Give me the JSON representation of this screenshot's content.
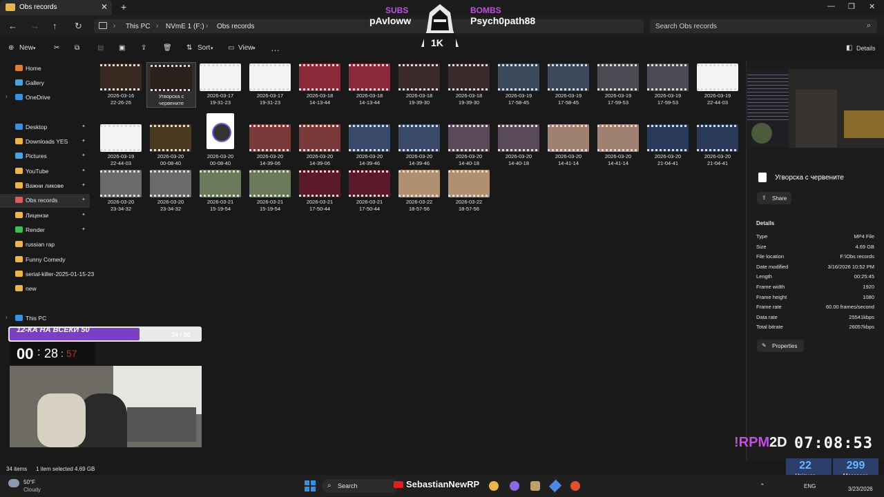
{
  "window": {
    "tab_title": "Obs records",
    "breadcrumb": [
      "This PC",
      "NVmE 1 (F:)",
      "Obs records"
    ],
    "search_placeholder": "Search Obs records"
  },
  "toolbar": {
    "new_label": "New",
    "sort_label": "Sort",
    "view_label": "View",
    "more_label": "…",
    "details_label": "Details"
  },
  "stream_overlay": {
    "subs_label": "SUBS",
    "subs_name": "pAvloww",
    "bombs_label": "BOMBS",
    "bombs_name": "Psych0path88",
    "badge": "1K",
    "goal_title": "12-КА НА ВСЕКИ 50",
    "goal_count": "34 / 50",
    "goal_progress": 0.68,
    "timer_h": "00",
    "timer_m": "28",
    "timer_s": "57",
    "rpm_label": "!RPM",
    "rpm_days": "2D",
    "rpm_clock": "07:08:53",
    "uniques_value": "22",
    "uniques_label": "Uniques",
    "messages_value": "299",
    "messages_label": "Messages",
    "taskbar_overlay_text": "SebastianNewRP"
  },
  "sidebar": {
    "items": [
      {
        "label": "Home",
        "icon": "home-icon",
        "color": "#e07b39",
        "pinned": false
      },
      {
        "label": "Gallery",
        "icon": "gallery-icon",
        "color": "#4aa3df",
        "pinned": false
      },
      {
        "label": "OneDrive",
        "icon": "cloud-icon",
        "color": "#3b8ee0",
        "pinned": false
      },
      {
        "label": "Desktop",
        "icon": "desktop-icon",
        "color": "#3b8ee0",
        "pinned": true
      },
      {
        "label": "Downloads YES",
        "icon": "folder-icon",
        "color": "#e8b64a",
        "pinned": true
      },
      {
        "label": "Pictures",
        "icon": "pictures-icon",
        "color": "#4aa3df",
        "pinned": true
      },
      {
        "label": "YouTube",
        "icon": "folder-icon",
        "color": "#e8b64a",
        "pinned": true
      },
      {
        "label": "Важни ликове",
        "icon": "folder-icon",
        "color": "#e8b64a",
        "pinned": true
      },
      {
        "label": "Obs records",
        "icon": "obs-icon",
        "color": "#e05a5a",
        "pinned": true
      },
      {
        "label": "Лицензи",
        "icon": "folder-icon",
        "color": "#e8b64a",
        "pinned": true
      },
      {
        "label": "Render",
        "icon": "check-icon",
        "color": "#3fbf5a",
        "pinned": true
      },
      {
        "label": "russian rap",
        "icon": "folder-icon",
        "color": "#e8b64a",
        "pinned": false
      },
      {
        "label": "Funny Comedy",
        "icon": "folder-icon",
        "color": "#e8b64a",
        "pinned": false
      },
      {
        "label": "serial-killer-2025-01-15-23",
        "icon": "folder-icon",
        "color": "#e8b64a",
        "pinned": false
      },
      {
        "label": "new",
        "icon": "folder-icon",
        "color": "#e8b64a",
        "pinned": false
      },
      {
        "label": "This PC",
        "icon": "pc-icon",
        "color": "#3b8ee0",
        "pinned": false
      }
    ]
  },
  "files": [
    {
      "name": [
        "2026-03-16",
        "22-26-26"
      ],
      "tone": "#3a2b22"
    },
    {
      "name": [
        "Угворска с",
        "червените"
      ],
      "tone": "#2a211c",
      "selected": true
    },
    {
      "name": [
        "2026-03-17",
        "19-31-23"
      ],
      "tone": "#f4f4f4"
    },
    {
      "name": [
        "2026-03-17",
        "19-31-23"
      ],
      "tone": "#f4f4f4"
    },
    {
      "name": [
        "2026-03-18",
        "14-13-44"
      ],
      "tone": "#8a2a3a"
    },
    {
      "name": [
        "2026-03-18",
        "14-13-44"
      ],
      "tone": "#8a2a3a"
    },
    {
      "name": [
        "2026-03-18",
        "19-39-30"
      ],
      "tone": "#3b2a2a"
    },
    {
      "name": [
        "2026-03-18",
        "19-39-30"
      ],
      "tone": "#3b2a2a"
    },
    {
      "name": [
        "2026-03-19",
        "17-58-45"
      ],
      "tone": "#3a4a5a"
    },
    {
      "name": [
        "2026-03-19",
        "17-58-45"
      ],
      "tone": "#3a4a5a"
    },
    {
      "name": [
        "2026-03-19",
        "17-59-53"
      ],
      "tone": "#4a4a52"
    },
    {
      "name": [
        "2026-03-19",
        "17-59-53"
      ],
      "tone": "#4a4a52"
    },
    {
      "name": [
        "2026-03-19",
        "22-44-03"
      ],
      "tone": "#f4f4f4"
    },
    {
      "name": [
        "2026-03-19",
        "22-44-03"
      ],
      "tone": "#f4f4f4"
    },
    {
      "name": [
        "2026-03-20",
        "00-08-40"
      ],
      "tone": "#4a3a22"
    },
    {
      "name": [
        "2026-03-20",
        "00-08-40"
      ],
      "tone": "#ffffff",
      "doc": true
    },
    {
      "name": [
        "2026-03-20",
        "14-39-06"
      ],
      "tone": "#7a3a3a"
    },
    {
      "name": [
        "2026-03-20",
        "14-39-06"
      ],
      "tone": "#7a3a3a"
    },
    {
      "name": [
        "2026-03-20",
        "14-39-46"
      ],
      "tone": "#3a4a6a"
    },
    {
      "name": [
        "2026-03-20",
        "14-39-46"
      ],
      "tone": "#3a4a6a"
    },
    {
      "name": [
        "2026-03-20",
        "14-40-18"
      ],
      "tone": "#5a4a5a"
    },
    {
      "name": [
        "2026-03-20",
        "14-40-18"
      ],
      "tone": "#5a4a5a"
    },
    {
      "name": [
        "2026-03-20",
        "14-41-14"
      ],
      "tone": "#a08070"
    },
    {
      "name": [
        "2026-03-20",
        "14-41-14"
      ],
      "tone": "#a08070"
    },
    {
      "name": [
        "2026-03-20",
        "21-04-41"
      ],
      "tone": "#2a3a5a"
    },
    {
      "name": [
        "2026-03-20",
        "21-04-41"
      ],
      "tone": "#2a3a5a"
    },
    {
      "name": [
        "2026-03-20",
        "23-34-32"
      ],
      "tone": "#6a6a6a"
    },
    {
      "name": [
        "2026-03-20",
        "23-34-32"
      ],
      "tone": "#6a6a6a"
    },
    {
      "name": [
        "2026-03-21",
        "15-19-54"
      ],
      "tone": "#6a7a5a"
    },
    {
      "name": [
        "2026-03-21",
        "15-19-54"
      ],
      "tone": "#6a7a5a"
    },
    {
      "name": [
        "2026-03-21",
        "17-50-44"
      ],
      "tone": "#5a1a2a"
    },
    {
      "name": [
        "2026-03-21",
        "17-50-44"
      ],
      "tone": "#5a1a2a"
    },
    {
      "name": [
        "2026-03-22",
        "18-57-56"
      ],
      "tone": "#b09070"
    },
    {
      "name": [
        "2026-03-22",
        "18-57-56"
      ],
      "tone": "#b09070"
    }
  ],
  "details": {
    "title": "Угворска с червените",
    "share_label": "Share",
    "section_label": "Details",
    "properties_label": "Properties",
    "rows": [
      {
        "k": "Type",
        "v": "MP4 File"
      },
      {
        "k": "Size",
        "v": "4.69 GB"
      },
      {
        "k": "File location",
        "v": "F:\\Obs records"
      },
      {
        "k": "Date modified",
        "v": "3/16/2026 10:52 PM"
      },
      {
        "k": "Length",
        "v": "00:25:45"
      },
      {
        "k": "Frame width",
        "v": "1920"
      },
      {
        "k": "Frame height",
        "v": "1080"
      },
      {
        "k": "Frame rate",
        "v": "60.00 frames/second"
      },
      {
        "k": "Data rate",
        "v": "25541kbps"
      },
      {
        "k": "Total bitrate",
        "v": "26057kbps"
      }
    ]
  },
  "status": {
    "items_count": "34 items",
    "selection": "1 item selected  4.69 GB"
  },
  "taskbar": {
    "weather_temp": "50°F",
    "weather_desc": "Cloudy",
    "search_label": "Search",
    "lang": "ENG",
    "date": "3/23/2026"
  }
}
